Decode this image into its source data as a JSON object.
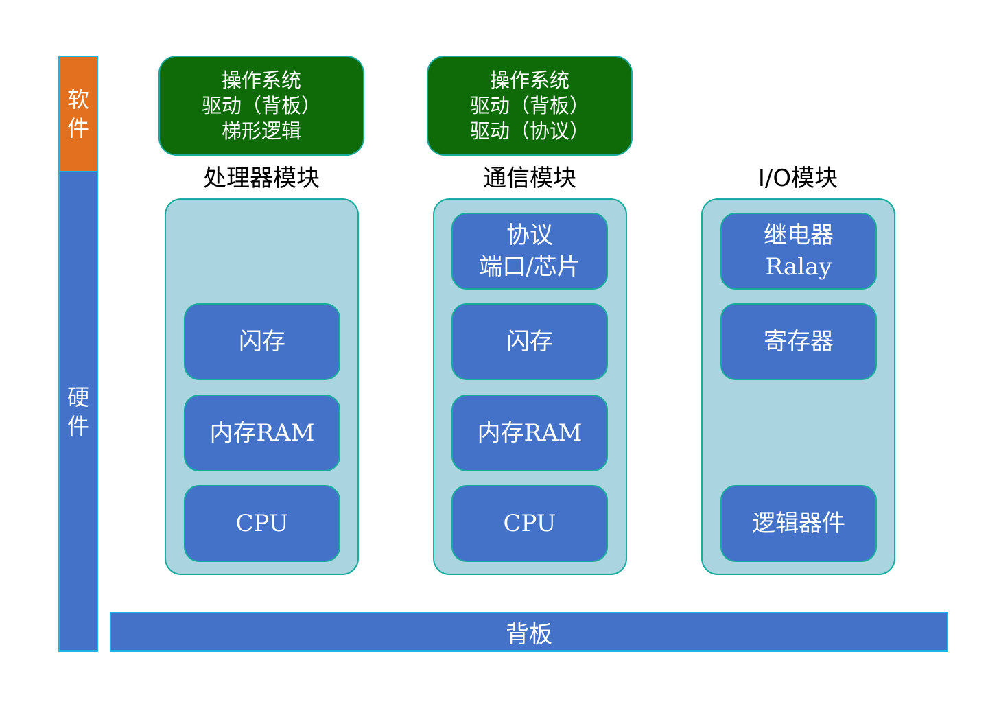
{
  "layers": {
    "software": {
      "chars": [
        "软",
        "件"
      ],
      "color": "#e2701f"
    },
    "hardware": {
      "chars": [
        "硬",
        "件"
      ],
      "color": "#4472c8"
    }
  },
  "software_boxes": [
    {
      "lines": [
        "操作系统",
        "驱动（背板）",
        "梯形逻辑"
      ]
    },
    {
      "lines": [
        "操作系统",
        "驱动（背板）",
        "驱动（协议）"
      ]
    }
  ],
  "modules": [
    {
      "title": "处理器模块",
      "chips": [
        [
          "闪存"
        ],
        [
          "内存RAM"
        ],
        [
          "CPU"
        ]
      ]
    },
    {
      "title": "通信模块",
      "chips": [
        [
          "协议",
          "端口/芯片"
        ],
        [
          "闪存"
        ],
        [
          "内存RAM"
        ],
        [
          "CPU"
        ]
      ]
    },
    {
      "title": "I/O模块",
      "chips": [
        [
          "继电器",
          "Ralay"
        ],
        [
          "寄存器"
        ],
        [
          "逻辑器件"
        ]
      ]
    }
  ],
  "backplane": {
    "label": "背板"
  },
  "colors": {
    "software_box": "#0e6b08",
    "module_bg": "#aad5e0",
    "chip": "#4472c8",
    "border": "#17ad9c"
  }
}
